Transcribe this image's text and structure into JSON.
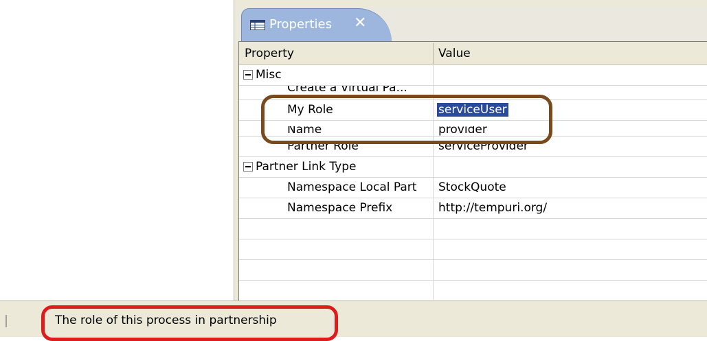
{
  "panel": {
    "title": "Properties",
    "close_glyph": "✕"
  },
  "table": {
    "headers": [
      "Property",
      "Value"
    ],
    "rows": [
      {
        "kind": "category",
        "property": "Misc",
        "value": ""
      },
      {
        "kind": "item",
        "property": "Create a Virtual Pa...",
        "value": ""
      },
      {
        "kind": "item",
        "property": "My Role",
        "value": "serviceUser",
        "selected": true
      },
      {
        "kind": "item",
        "property": "Name",
        "value": "provider"
      },
      {
        "kind": "item",
        "property": "Partner Role",
        "value": "serviceProvider"
      },
      {
        "kind": "category",
        "property": "Partner Link Type",
        "value": ""
      },
      {
        "kind": "item",
        "property": "Namespace Local Part",
        "value": "StockQuote"
      },
      {
        "kind": "item",
        "property": "Namespace Prefix",
        "value": "http://tempuri.org/"
      }
    ]
  },
  "statusbar": {
    "text": "The role of this process in partnership"
  },
  "colors": {
    "tab_bg": "#9cb6dd",
    "selection": "#2a4a9b",
    "annotation_brown": "#7a4a1f",
    "annotation_red": "#dd1d1d"
  },
  "icons": {
    "tab": "properties-table-icon",
    "collapse": "collapse-minus-icon"
  }
}
